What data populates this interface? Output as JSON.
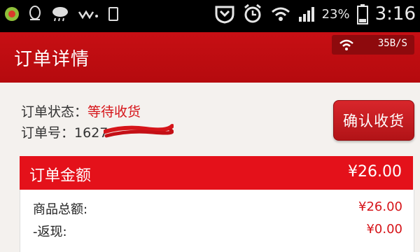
{
  "status_bar": {
    "battery_percent": "23%",
    "time": "3:16",
    "icons": [
      "app-icon",
      "qq-icon",
      "weather-icon",
      "signal-wave-icon",
      "sim-icon",
      "shield-icon",
      "alarm-icon",
      "wifi-icon",
      "cell-signal-icon",
      "battery-icon"
    ]
  },
  "header": {
    "title": "订单详情",
    "network_speed": "35B/S"
  },
  "order": {
    "status_label": "订单状态：",
    "status_value": "等待收货",
    "number_label": "订单号：",
    "number_partial": "1627"
  },
  "actions": {
    "confirm_label": "确认收货"
  },
  "summary": {
    "header_label": "订单金额",
    "header_value": "¥26.00",
    "lines": [
      {
        "label": "商品总额:",
        "value": "¥26.00"
      },
      {
        "label": "-返现:",
        "value": "¥0.00"
      }
    ]
  },
  "colors": {
    "accent": "#e4111a",
    "title_bar": "#c70f14",
    "status_red": "#d6151a"
  }
}
